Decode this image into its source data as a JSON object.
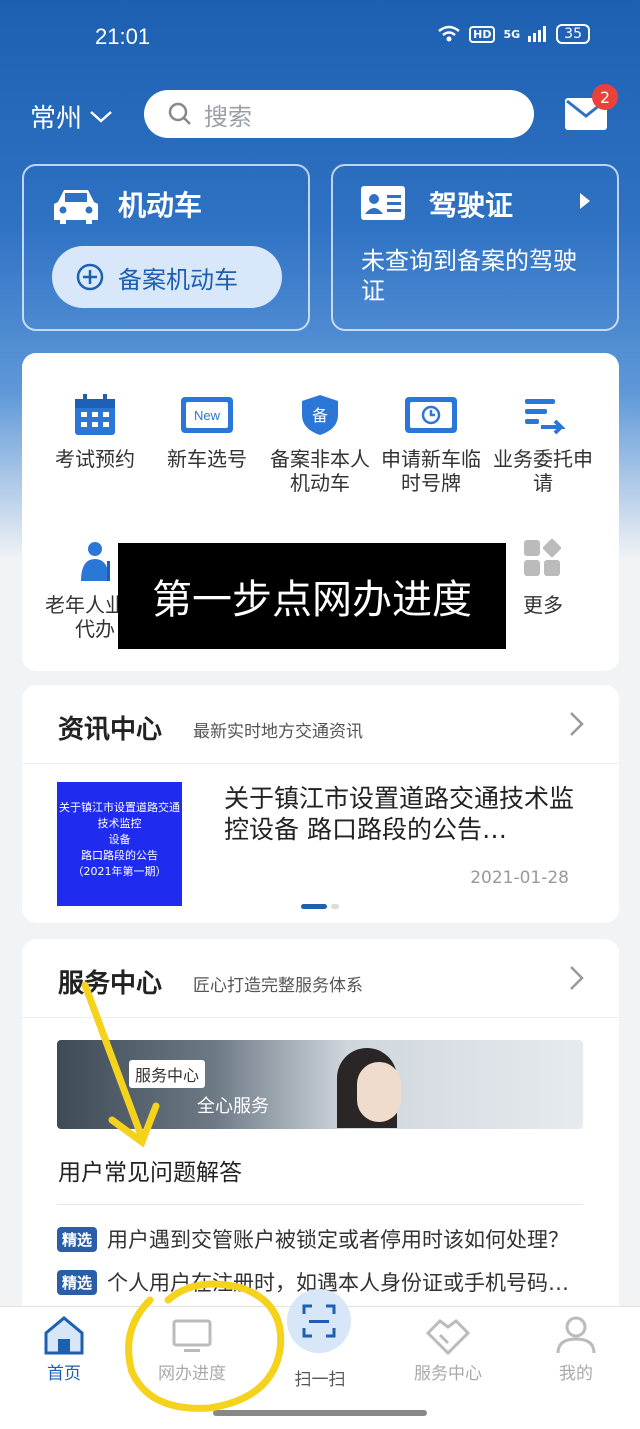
{
  "status_bar": {
    "time": "21:01",
    "hd": "HD",
    "network": "5G",
    "battery": "35"
  },
  "header": {
    "city": "常州",
    "search_placeholder": "搜索",
    "unread_count": "2"
  },
  "vehicle_card": {
    "title": "机动车",
    "action_label": "备案机动车"
  },
  "license_card": {
    "title": "驾驶证",
    "message": "未查询到备案的驾驶证"
  },
  "services": [
    {
      "label": "考试预约",
      "icon": "calendar-icon"
    },
    {
      "label": "新车选号",
      "icon": "new-plate-icon"
    },
    {
      "label": "备案非本人机动车",
      "icon": "shield-icon"
    },
    {
      "label": "申请新车临时号牌",
      "icon": "temp-plate-icon"
    },
    {
      "label": "业务委托申请",
      "icon": "delegate-icon"
    },
    {
      "label": "老年人业务代办",
      "icon": "elder-icon"
    },
    {
      "label": "更多",
      "icon": "more-icon"
    }
  ],
  "overlay_caption": "第一步点网办进度",
  "news": {
    "title": "资讯中心",
    "subtitle": "最新实时地方交通资讯",
    "thumb_lines": [
      "关于镇江市设置道路交通技术监控",
      "设备",
      "路口路段的公告",
      "（2021年第一期）"
    ],
    "item_title": "关于镇江市设置道路交通技术监控设备 路口路段的公告…",
    "item_date": "2021-01-28"
  },
  "service_center": {
    "title": "服务中心",
    "subtitle": "匠心打造完整服务体系",
    "banner_tag": "服务中心",
    "banner_sub": "全心服务",
    "faq_heading": "用户常见问题解答",
    "faq_items": [
      {
        "tag": "精选",
        "text": "用户遇到交管账户被锁定或者停用时该如何处理？"
      },
      {
        "tag": "精选",
        "text": "个人用户在注册时，如遇本人身份证或手机号码…"
      }
    ]
  },
  "bottom_nav": [
    {
      "label": "首页",
      "icon": "home-icon",
      "active": true
    },
    {
      "label": "网办进度",
      "icon": "monitor-icon",
      "active": false
    },
    {
      "label": "扫一扫",
      "icon": "scan-icon",
      "active": false
    },
    {
      "label": "服务中心",
      "icon": "handshake-icon",
      "active": false
    },
    {
      "label": "我的",
      "icon": "user-icon",
      "active": false
    }
  ],
  "colors": {
    "primary": "#1d5fb0",
    "badge": "#e9423a",
    "annotation": "#f5d21c"
  }
}
